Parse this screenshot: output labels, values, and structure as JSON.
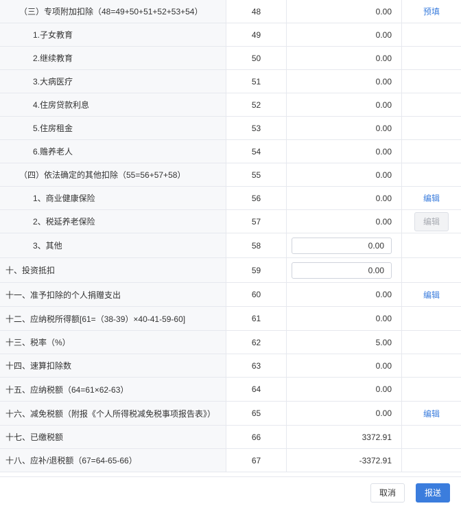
{
  "colors": {
    "link": "#3b7ddd",
    "primary": "#3b7ddd",
    "label_bg": "#f7f8fa",
    "border": "#e6e8ee"
  },
  "rows": [
    {
      "label": "（三）专项附加扣除（48=49+50+51+52+53+54）",
      "no": "48",
      "value": "0.00",
      "action": "预填"
    },
    {
      "label": "1.子女教育",
      "no": "49",
      "value": "0.00"
    },
    {
      "label": "2.继续教育",
      "no": "50",
      "value": "0.00"
    },
    {
      "label": "3.大病医疗",
      "no": "51",
      "value": "0.00"
    },
    {
      "label": "4.住房贷款利息",
      "no": "52",
      "value": "0.00"
    },
    {
      "label": "5.住房租金",
      "no": "53",
      "value": "0.00"
    },
    {
      "label": "6.赡养老人",
      "no": "54",
      "value": "0.00"
    },
    {
      "label": "（四）依法确定的其他扣除（55=56+57+58）",
      "no": "55",
      "value": "0.00"
    },
    {
      "label": "1、商业健康保险",
      "no": "56",
      "value": "0.00",
      "action": "编辑"
    },
    {
      "label": "2、税延养老保险",
      "no": "57",
      "value": "0.00",
      "action": "编辑"
    },
    {
      "label": "3、其他",
      "no": "58",
      "value": "0.00"
    },
    {
      "label": "十、投资抵扣",
      "no": "59",
      "value": "0.00"
    },
    {
      "label": "十一、准予扣除的个人捐赠支出",
      "no": "60",
      "value": "0.00",
      "action": "编辑"
    },
    {
      "label": "十二、应纳税所得额[61=（38-39）×40-41-59-60]",
      "no": "61",
      "value": "0.00"
    },
    {
      "label": "十三、税率（%）",
      "no": "62",
      "value": "5.00"
    },
    {
      "label": "十四、速算扣除数",
      "no": "63",
      "value": "0.00"
    },
    {
      "label": "十五、应纳税额（64=61×62-63）",
      "no": "64",
      "value": "0.00"
    },
    {
      "label": "十六、减免税额（附报《个人所得税减免税事项报告表》）",
      "no": "65",
      "value": "0.00",
      "action": "编辑"
    },
    {
      "label": "十七、已缴税额",
      "no": "66",
      "value": "3372.91"
    },
    {
      "label": "十八、应补/退税额（67=64-65-66）",
      "no": "67",
      "value": "-3372.91"
    }
  ],
  "footer": {
    "cancel_label": "取消",
    "submit_label": "报送"
  }
}
